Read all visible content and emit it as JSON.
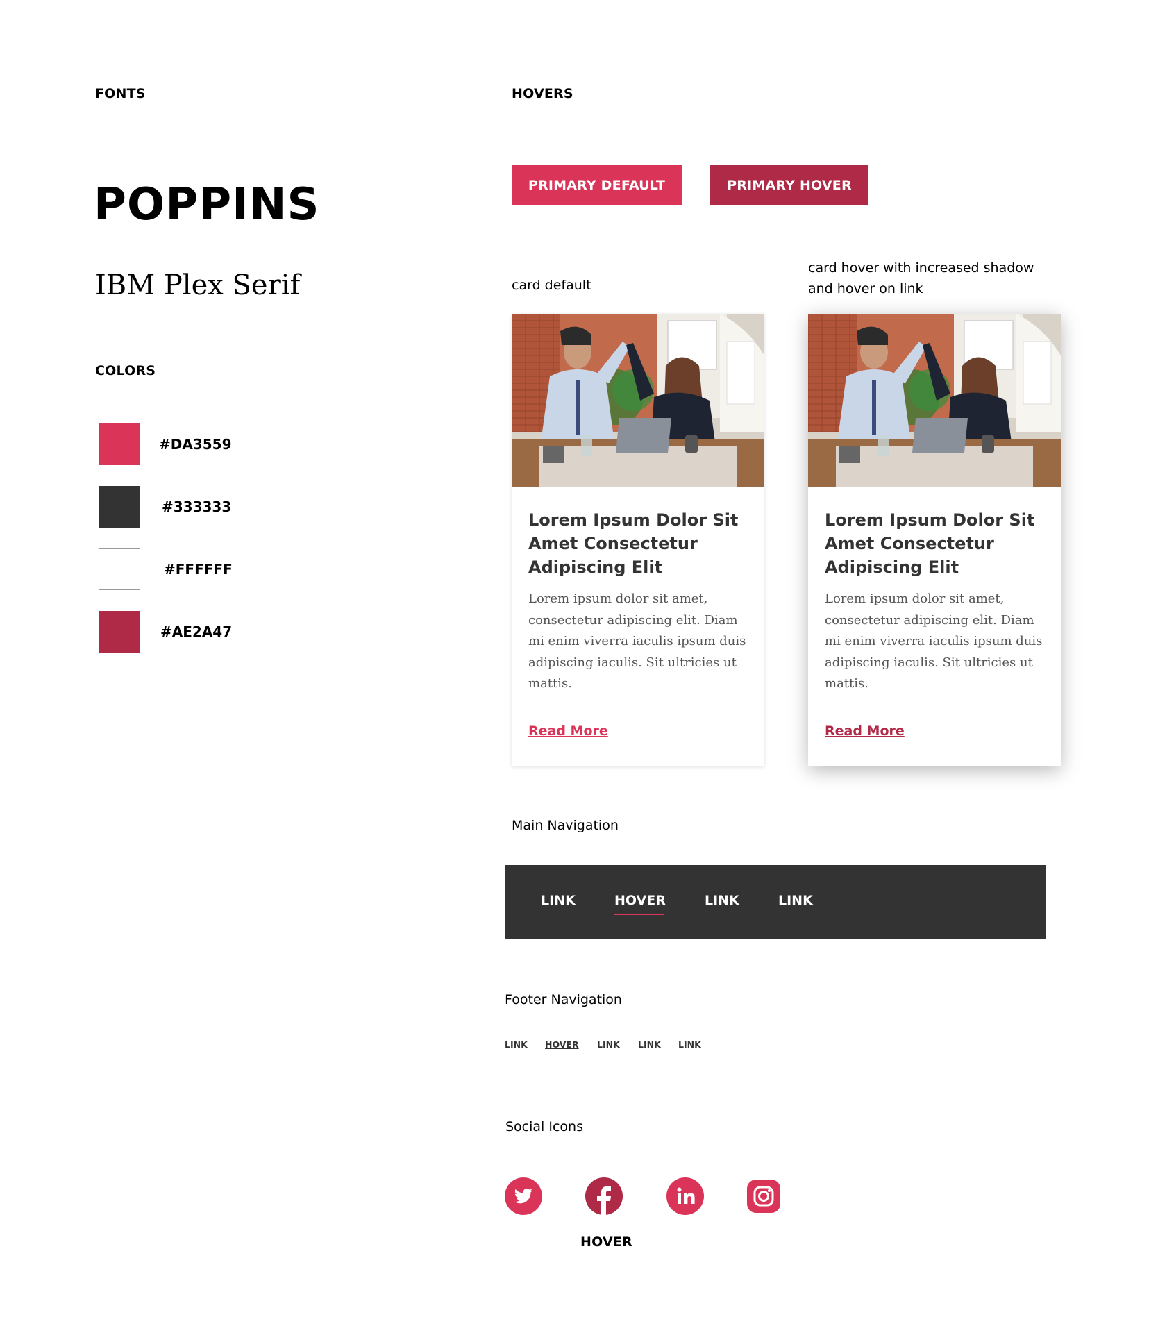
{
  "fonts": {
    "heading": "FONTS",
    "primary_name": "POPPINS",
    "secondary_name": "IBM Plex Serif"
  },
  "colors": {
    "heading": "COLORS",
    "swatches": [
      {
        "hex": "#DA3559",
        "label": "#DA3559"
      },
      {
        "hex": "#333333",
        "label": "#333333"
      },
      {
        "hex": "#FFFFFF",
        "label": "#FFFFFF"
      },
      {
        "hex": "#AE2A47",
        "label": "#AE2A47"
      }
    ]
  },
  "hovers": {
    "heading": "HOVERS",
    "primary_default_label": "PRIMARY DEFAULT",
    "primary_default_color": "#DA3559",
    "primary_hover_label": "PRIMARY HOVER",
    "primary_hover_color": "#AE2A47"
  },
  "cards": {
    "default_caption": "card default",
    "hover_caption_line1": "card hover with increased shadow",
    "hover_caption_line2": "and hover on link",
    "default": {
      "title": "Lorem Ipsum Dolor Sit Amet Consectetur Adipiscing Elit",
      "body": "Lorem ipsum dolor sit amet, consectetur adipiscing elit. Diam mi enim viverra iaculis ipsum duis adipiscing iaculis. Sit ultricies ut mattis.",
      "link": "Read More",
      "link_color": "#DA3559"
    },
    "hover": {
      "title": "Lorem Ipsum Dolor Sit Amet Consectetur Adipiscing Elit",
      "body": "Lorem ipsum dolor sit amet, consectetur adipiscing elit. Diam mi enim viverra iaculis ipsum duis adipiscing iaculis. Sit ultricies ut mattis.",
      "link": "Read More",
      "link_color": "#AE2A47"
    }
  },
  "main_nav": {
    "caption": "Main Navigation",
    "links": [
      "LINK",
      "HOVER",
      "LINK",
      "LINK"
    ],
    "bar_color": "#333333",
    "underline_color": "#DA3559"
  },
  "footer_nav": {
    "caption": "Footer Navigation",
    "links": [
      "LINK",
      "HOVER",
      "LINK",
      "LINK",
      "LINK"
    ]
  },
  "social": {
    "caption": "Social Icons",
    "icons": [
      "twitter-icon",
      "facebook-icon",
      "linkedin-icon",
      "instagram-icon"
    ],
    "default_color": "#DA3559",
    "hover_color": "#AE2A47",
    "hover_label": "HOVER"
  }
}
